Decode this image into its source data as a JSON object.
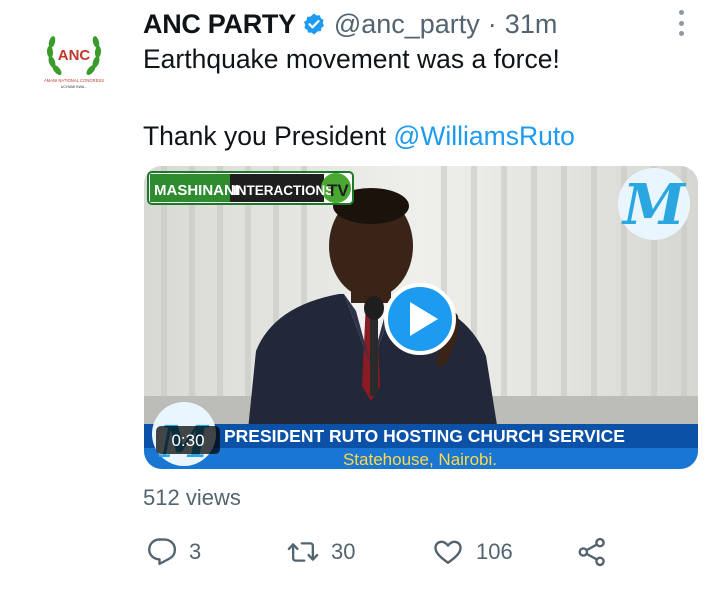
{
  "tweet": {
    "author_name": "ANC PARTY",
    "handle": "@anc_party",
    "separator": "·",
    "time": "31m",
    "text_line1": "Earthquake movement was a force!",
    "text_line2_prefix": "Thank you President ",
    "mention": "@WilliamsRuto",
    "views": "512 views"
  },
  "avatar": {
    "logo_text": "ANC",
    "subtitle": "AMANI NATIONAL CONGRESS",
    "motto": "UCHUMI KWA..."
  },
  "video": {
    "duration": "0:30",
    "channel_logo": "MASHINANI INTERACTIONS TV",
    "banner_title": "PRESIDENT RUTO HOSTING CHURCH SERVICE",
    "banner_subtitle": "Statehouse, Nairobi.",
    "watermark": "M"
  },
  "actions": {
    "reply_count": "3",
    "retweet_count": "30",
    "like_count": "106"
  },
  "icons": [
    "verified-badge-icon",
    "more-options-icon",
    "play-icon",
    "reply-icon",
    "retweet-icon",
    "like-icon",
    "share-icon"
  ],
  "colors": {
    "accent": "#1d9bf0",
    "muted": "#536471",
    "banner": "#0c51a8"
  }
}
